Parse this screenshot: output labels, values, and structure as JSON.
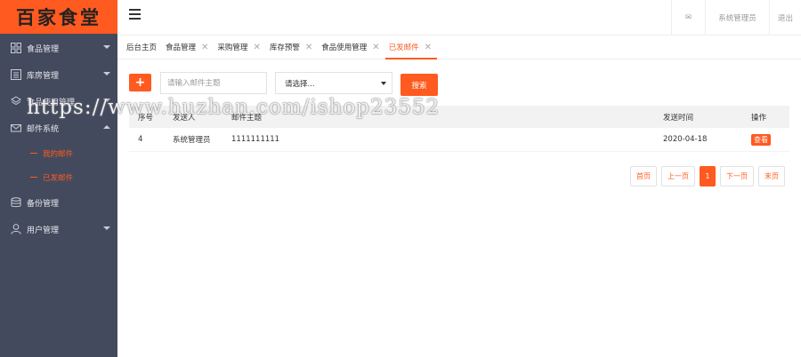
{
  "logo": {
    "text": "百家食堂"
  },
  "sidebar": {
    "items": [
      {
        "label": "食品管理",
        "icon": "grid-icon"
      },
      {
        "label": "库房管理",
        "icon": "list-icon"
      },
      {
        "label": "食品使用管理",
        "icon": "layers-icon"
      },
      {
        "label": "邮件系统",
        "icon": "mail-icon"
      },
      {
        "label": "备份管理",
        "icon": "database-icon"
      },
      {
        "label": "用户管理",
        "icon": "user-icon"
      }
    ],
    "mail_sub": [
      {
        "label": "我的邮件"
      },
      {
        "label": "已发邮件"
      }
    ]
  },
  "header": {
    "right": [
      {
        "label": "✉",
        "icon": "mail-icon"
      },
      {
        "label": "系统管理员"
      },
      {
        "label": "退出"
      }
    ]
  },
  "tabs": [
    {
      "label": "后台主页",
      "closable": false
    },
    {
      "label": "食品管理",
      "closable": true
    },
    {
      "label": "采购管理",
      "closable": true
    },
    {
      "label": "库存预警",
      "closable": true
    },
    {
      "label": "食品使用管理",
      "closable": true
    },
    {
      "label": "已发邮件",
      "closable": true,
      "active": true
    }
  ],
  "toolbar": {
    "add_label": "+",
    "search_placeholder": "请输入邮件主题",
    "select_value": "请选择...",
    "search_label": "搜索"
  },
  "table": {
    "headers": [
      "序号",
      "发送人",
      "邮件主题",
      "发送时间",
      "操作"
    ],
    "rows": [
      {
        "id": "4",
        "sender": "系统管理员",
        "subject": "1111111111",
        "date": "2020-04-18",
        "action": "查看"
      }
    ]
  },
  "pagination": {
    "first": "首页",
    "prev": "上一页",
    "current": "1",
    "next": "下一页",
    "last": "末页"
  },
  "watermark": "https://www.huzhan.com/ishop23552",
  "colors": {
    "accent": "#ff5a1f",
    "sidebar": "#434a5e"
  }
}
